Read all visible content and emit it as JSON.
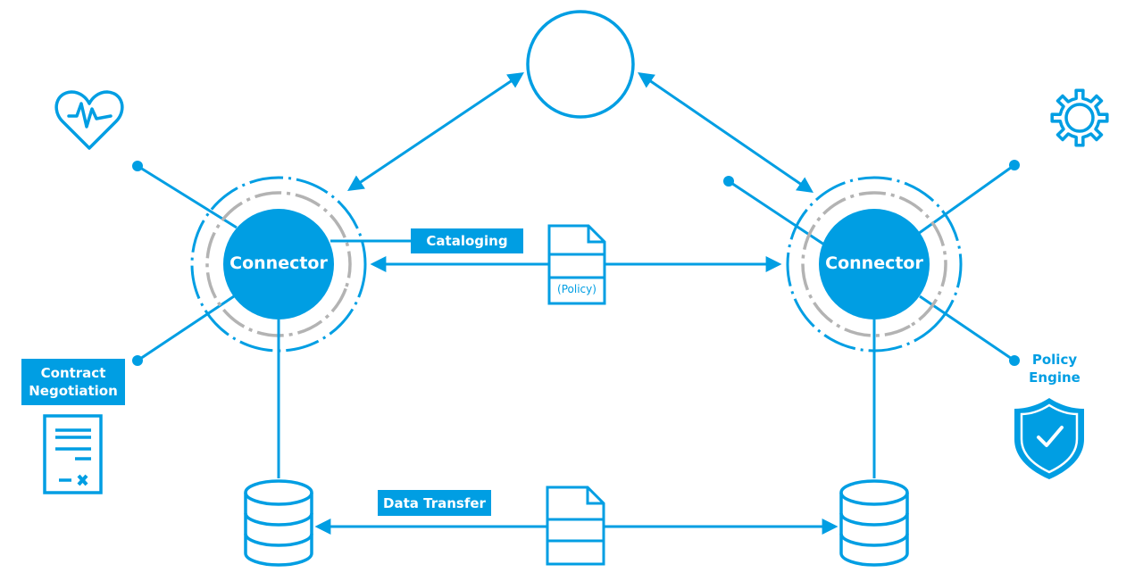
{
  "colors": {
    "primary": "#009ee3",
    "ring_gray": "#b3b3b3",
    "background": "#ffffff"
  },
  "nodes": {
    "central_registry": {
      "label": "",
      "icon": "empty-circle"
    },
    "left_connector": {
      "label": "Connector"
    },
    "right_connector": {
      "label": "Connector"
    },
    "left_database": {
      "icon": "database-icon"
    },
    "right_database": {
      "icon": "database-icon"
    }
  },
  "labels": {
    "cataloging": "Cataloging",
    "data_transfer": "Data Transfer",
    "contract_negotiation": "Contract Negotiation",
    "policy_engine": "Policy Engine",
    "policy_document": "(Policy)"
  },
  "icons": [
    "heart-pulse-icon",
    "gear-icon",
    "contract-document-icon",
    "shield-check-icon",
    "document-icon"
  ],
  "edges": [
    {
      "from": "left_connector",
      "to": "central_registry",
      "type": "bidirectional"
    },
    {
      "from": "right_connector",
      "to": "central_registry",
      "type": "bidirectional"
    },
    {
      "from": "left_connector",
      "to": "right_connector",
      "type": "bidirectional",
      "label": "Cataloging",
      "via": "(Policy)"
    },
    {
      "from": "left_database",
      "to": "right_database",
      "type": "bidirectional",
      "label": "Data Transfer"
    },
    {
      "from": "left_connector",
      "to": "left_database",
      "type": "line"
    },
    {
      "from": "right_connector",
      "to": "right_database",
      "type": "line"
    }
  ]
}
